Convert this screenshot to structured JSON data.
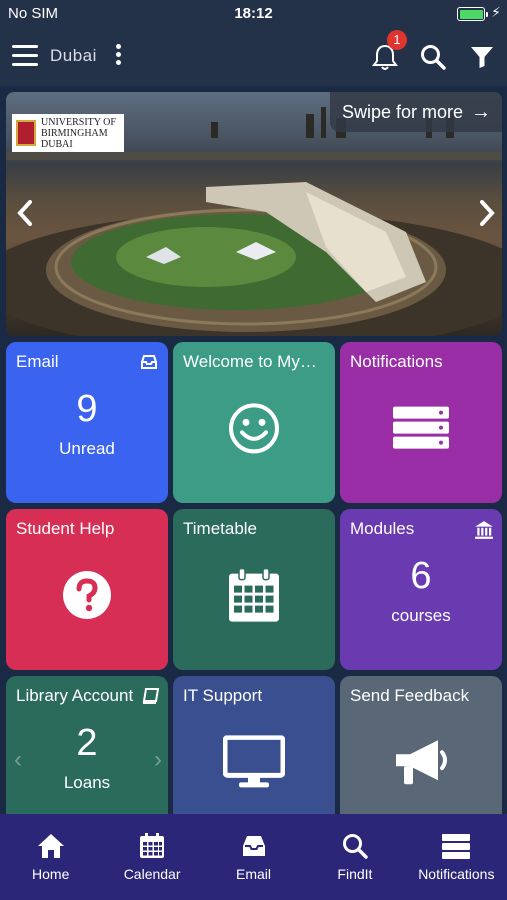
{
  "status": {
    "carrier": "No SIM",
    "time": "18:12"
  },
  "nav": {
    "location": "Dubai",
    "notification_count": "1"
  },
  "banner": {
    "swipe_text": "Swipe for more",
    "logo_lines": [
      "UNIVERSITY OF",
      "BIRMINGHAM",
      "DUBAI"
    ]
  },
  "tiles": [
    {
      "title": "Email",
      "value": "9",
      "sub": "Unread",
      "color": "#3a63ef",
      "icon": "inbox-icon"
    },
    {
      "title": "Welcome to My…",
      "color": "#3c9c86",
      "icon": "smiley-icon"
    },
    {
      "title": "Notifications",
      "color": "#9a2ea6",
      "icon": "server-icon"
    },
    {
      "title": "Student Help",
      "color": "#d62e55",
      "icon": "question-icon"
    },
    {
      "title": "Timetable",
      "color": "#2a6b5c",
      "icon": "calendar-icon"
    },
    {
      "title": "Modules",
      "value": "6",
      "sub": "courses",
      "color": "#6a3ab0",
      "icon": "institution-icon"
    },
    {
      "title": "Library Account",
      "value": "2",
      "sub": "Loans",
      "color": "#2a6b5c",
      "icon": "book-icon"
    },
    {
      "title": "IT Support",
      "color": "#3a4f8f",
      "icon": "monitor-icon"
    },
    {
      "title": "Send Feedback",
      "color": "#5a6776",
      "icon": "megaphone-icon"
    }
  ],
  "tabs": [
    {
      "label": "Home",
      "icon": "home-icon"
    },
    {
      "label": "Calendar",
      "icon": "calendar-icon"
    },
    {
      "label": "Email",
      "icon": "inbox-icon"
    },
    {
      "label": "FindIt",
      "icon": "search-icon"
    },
    {
      "label": "Notifications",
      "icon": "server-icon"
    }
  ]
}
